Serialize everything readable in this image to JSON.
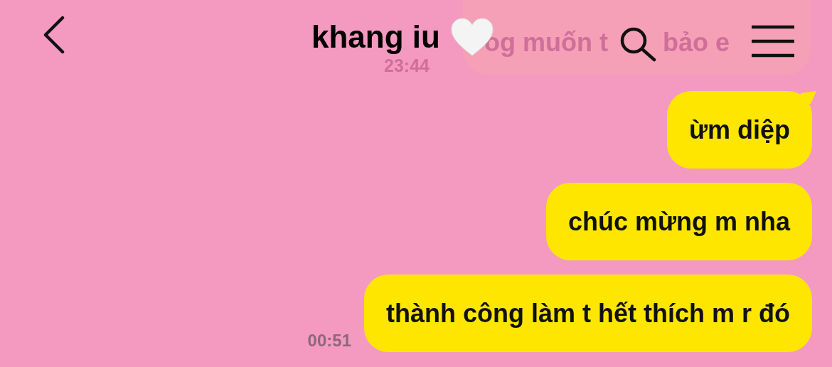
{
  "header": {
    "title": "khang iu"
  },
  "faded_message": {
    "parts": [
      "og muốn t",
      "bảo e"
    ],
    "time": "23:44"
  },
  "messages": [
    {
      "text": "ừm diệp",
      "tail": true
    },
    {
      "text": "chúc mừng m nha",
      "tail": false
    },
    {
      "text": "thành công làm t hết thích m r đó",
      "tail": false
    }
  ],
  "last_time": "00:51"
}
